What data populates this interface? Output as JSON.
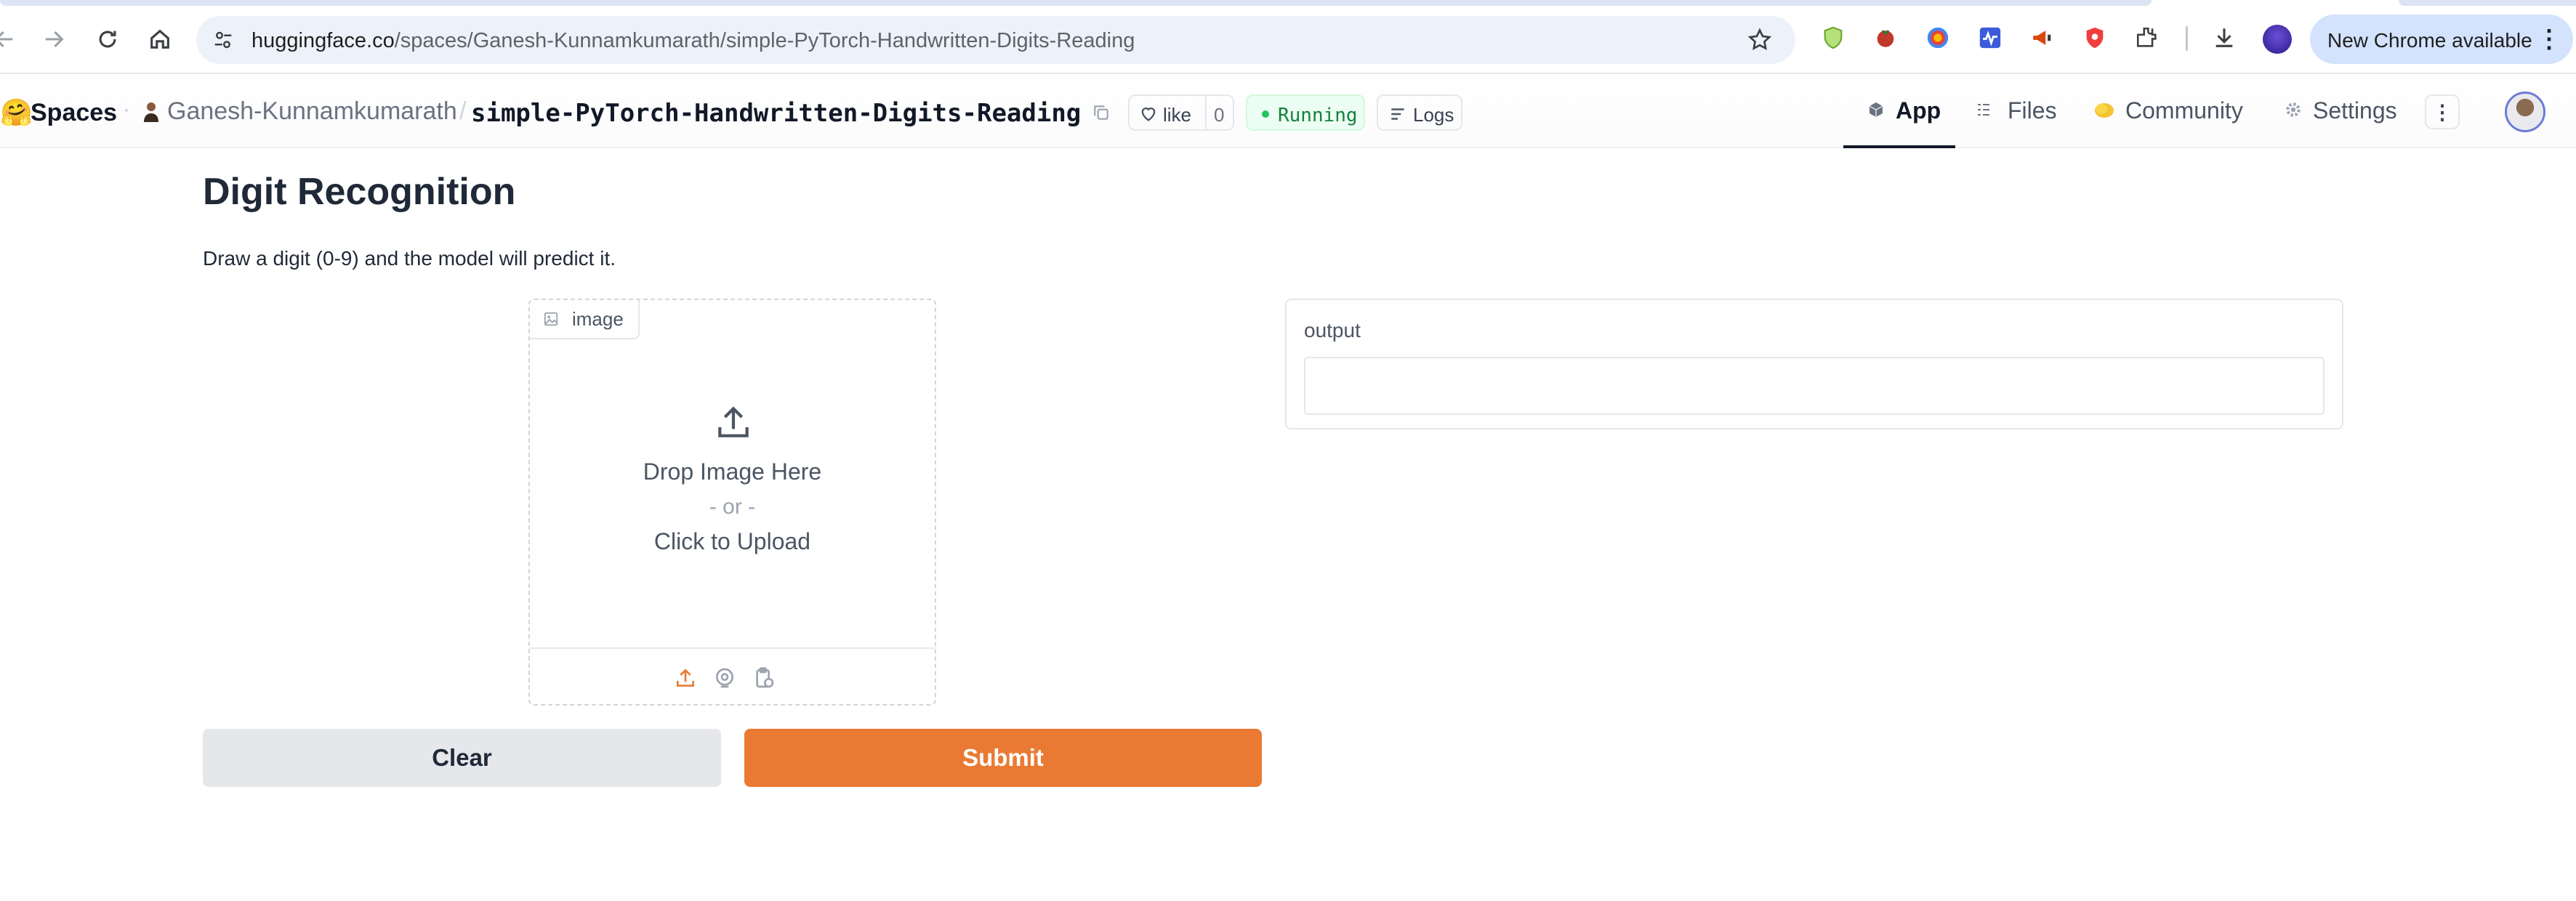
{
  "browser": {
    "url_host": "huggingface.co",
    "url_path": "/spaces/Ganesh-Kunnamkumarath/simple-PyTorch-Handwritten-Digits-Reading",
    "update_label": "New Chrome available",
    "icons": [
      "back-icon",
      "forward-icon",
      "reload-icon",
      "home-icon",
      "site-settings-icon",
      "bookmark-star-icon",
      "extensions-icon",
      "downloads-icon",
      "menu-icon"
    ]
  },
  "hf_header": {
    "spaces_label": "Spaces",
    "owner": "Ganesh-Kunnamkumarath",
    "slash": "/",
    "repo": "simple-PyTorch-Handwritten-Digits-Reading",
    "like_label": "like",
    "like_count": "0",
    "status": "Running",
    "logs_label": "Logs",
    "tabs": [
      {
        "label": "App",
        "icon": "cube-icon",
        "active": true
      },
      {
        "label": "Files",
        "icon": "files-icon",
        "active": false
      },
      {
        "label": "Community",
        "icon": "community-icon",
        "active": false
      },
      {
        "label": "Settings",
        "icon": "gear-icon",
        "active": false
      }
    ]
  },
  "app": {
    "title": "Digit Recognition",
    "description": "Draw a digit (0-9) and the model will predict it.",
    "image_input": {
      "label": "image",
      "drop_text": "Drop Image Here",
      "or_text": "- or -",
      "click_text": "Click to Upload"
    },
    "output": {
      "label": "output",
      "value": ""
    },
    "buttons": {
      "clear": "Clear",
      "submit": "Submit"
    }
  },
  "colors": {
    "accent": "#ea7a33",
    "running_green": "#22c55e",
    "update_bg": "#d3e3fd"
  }
}
